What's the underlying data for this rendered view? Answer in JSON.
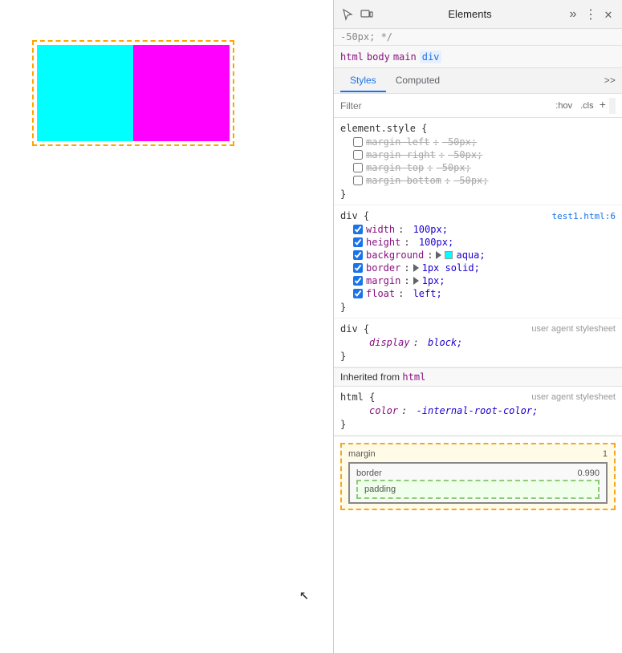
{
  "left_panel": {
    "preview": {
      "cyan_bg": "cyan",
      "magenta_bg": "magenta"
    }
  },
  "devtools": {
    "topbar": {
      "title": "Elements",
      "icons": [
        "cursor-inspect",
        "device-toggle",
        "more-tabs",
        "more-options",
        "close"
      ]
    },
    "breadcrumb": {
      "items": [
        "html",
        "body",
        "main",
        "div"
      ]
    },
    "tabs": {
      "items": [
        "Styles",
        "Computed"
      ],
      "active": "Styles",
      "chevron": ">>"
    },
    "filter": {
      "placeholder": "Filter",
      "buttons": [
        ":hov",
        ".cls",
        "+"
      ]
    },
    "styles": {
      "top_comment": "-50px; */",
      "element_style": {
        "selector": "element.style {",
        "properties": [
          {
            "name": "margin-left",
            "value": "-50px;",
            "crossed": true
          },
          {
            "name": "margin-right",
            "value": "-50px;",
            "crossed": true
          },
          {
            "name": "margin-top",
            "value": "-50px;",
            "crossed": true
          },
          {
            "name": "margin-bottom",
            "value": "-50px;",
            "crossed": true
          }
        ],
        "close": "}"
      },
      "div_rule": {
        "selector": "div {",
        "source": "test1.html:6",
        "properties": [
          {
            "name": "width",
            "value": "100px;",
            "crossed": false,
            "type": "normal"
          },
          {
            "name": "height",
            "value": "100px;",
            "crossed": false,
            "type": "normal"
          },
          {
            "name": "background",
            "value": "aqua;",
            "crossed": false,
            "type": "color",
            "color": "#00ffff",
            "has_triangle": true
          },
          {
            "name": "border",
            "value": "1px solid;",
            "crossed": false,
            "type": "triangle"
          },
          {
            "name": "margin",
            "value": "1px;",
            "crossed": false,
            "type": "triangle"
          },
          {
            "name": "float",
            "value": "left;",
            "crossed": false,
            "type": "normal"
          }
        ],
        "close": "}"
      },
      "div_user_agent": {
        "selector": "div {",
        "source": "user agent stylesheet",
        "properties": [
          {
            "name": "display",
            "value": "block;",
            "crossed": false,
            "italic": true
          }
        ],
        "close": "}"
      },
      "inherited_header": "Inherited from",
      "inherited_tag": "html",
      "html_rule": {
        "selector": "html {",
        "source": "user agent stylesheet",
        "properties": [
          {
            "name": "color",
            "value": "-internal-root-color;",
            "crossed": false,
            "italic": true
          }
        ],
        "close": "}"
      }
    },
    "box_model": {
      "margin_label": "margin",
      "margin_value": "1",
      "border_label": "border",
      "border_value": "0.990",
      "padding_label": "padding"
    }
  }
}
